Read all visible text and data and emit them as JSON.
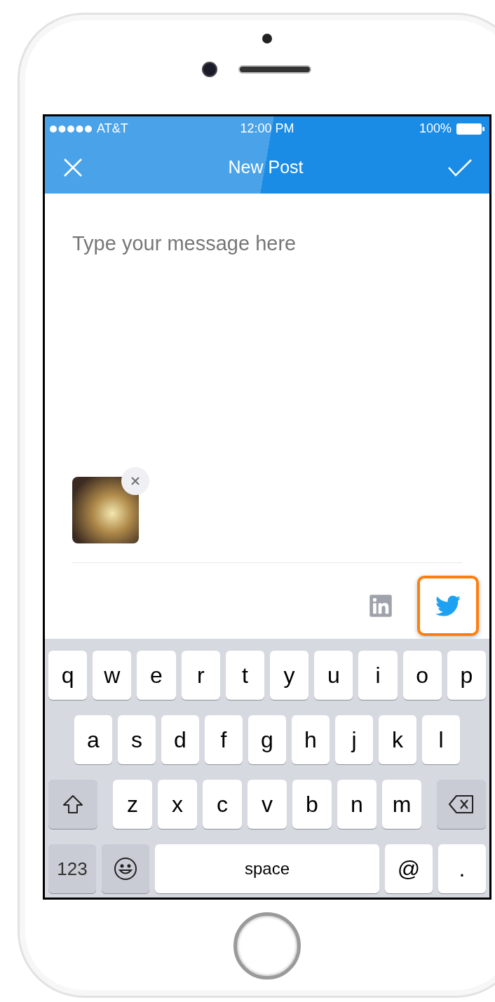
{
  "status_bar": {
    "carrier": "AT&T",
    "time": "12:00 PM",
    "battery": "100%"
  },
  "nav_bar": {
    "title": "New Post"
  },
  "message": {
    "placeholder": "Type your message here"
  },
  "networks": [
    {
      "kind": "linkedin",
      "selected": false
    },
    {
      "kind": "twitter",
      "selected": true
    }
  ],
  "keyboard": {
    "rows": [
      {
        "keys": [
          {
            "kind": "letter",
            "label": "q"
          },
          {
            "kind": "letter",
            "label": "w"
          },
          {
            "kind": "letter",
            "label": "e"
          },
          {
            "kind": "letter",
            "label": "r"
          },
          {
            "kind": "letter",
            "label": "t"
          },
          {
            "kind": "letter",
            "label": "y"
          },
          {
            "kind": "letter",
            "label": "u"
          },
          {
            "kind": "letter",
            "label": "i"
          },
          {
            "kind": "letter",
            "label": "o"
          },
          {
            "kind": "letter",
            "label": "p"
          }
        ]
      },
      {
        "keys": [
          {
            "kind": "letter",
            "label": "a"
          },
          {
            "kind": "letter",
            "label": "s"
          },
          {
            "kind": "letter",
            "label": "d"
          },
          {
            "kind": "letter",
            "label": "f"
          },
          {
            "kind": "letter",
            "label": "g"
          },
          {
            "kind": "letter",
            "label": "h"
          },
          {
            "kind": "letter",
            "label": "j"
          },
          {
            "kind": "letter",
            "label": "k"
          },
          {
            "kind": "letter",
            "label": "l"
          }
        ]
      },
      {
        "keys": [
          {
            "kind": "shift"
          },
          {
            "kind": "letter",
            "label": "z"
          },
          {
            "kind": "letter",
            "label": "x"
          },
          {
            "kind": "letter",
            "label": "c"
          },
          {
            "kind": "letter",
            "label": "v"
          },
          {
            "kind": "letter",
            "label": "b"
          },
          {
            "kind": "letter",
            "label": "n"
          },
          {
            "kind": "letter",
            "label": "m"
          },
          {
            "kind": "delete"
          }
        ]
      },
      {
        "keys": [
          {
            "kind": "numbers",
            "label": "123"
          },
          {
            "kind": "emoji"
          },
          {
            "kind": "space",
            "label": "space"
          },
          {
            "kind": "char",
            "label": "@"
          },
          {
            "kind": "char",
            "label": "."
          }
        ]
      }
    ]
  }
}
